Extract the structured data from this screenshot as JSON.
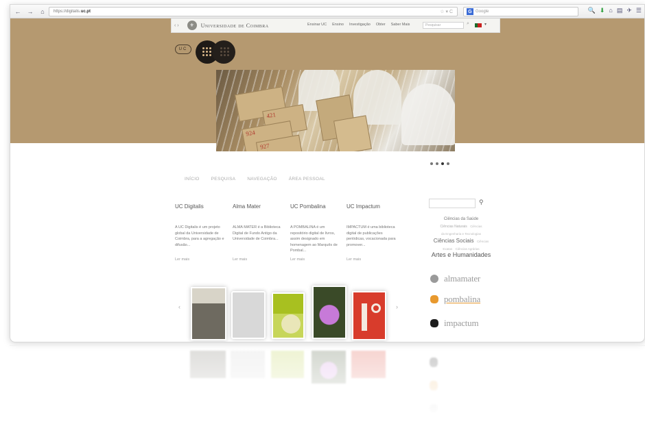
{
  "browser": {
    "nav_back": "←",
    "nav_forward": "→",
    "nav_home": "⌂",
    "url_prefix": "https://digitalis.",
    "url_domain": "uc.pt",
    "url_controls": "☆ ▾ C",
    "search_engine_letter": "G",
    "search_placeholder": "Google",
    "toolbar_icons": [
      "🔍",
      "⬇",
      "⌂",
      "▤",
      "✈",
      "☰"
    ]
  },
  "uc_bar": {
    "seal_glyph": "⚜",
    "arrows_left": "‹ ›",
    "name": "Universidade de Coimbra",
    "links": [
      "Ensinar UC",
      "Ensino",
      "Investigação",
      "Obter",
      "Saber Mais"
    ],
    "search_placeholder": "Pesquisar",
    "search_glyph": "⌕",
    "caret": "▾"
  },
  "logo": {
    "uc_text": "UC"
  },
  "hero_cards": [
    "421",
    "924",
    "927"
  ],
  "nav": {
    "items": [
      "INÍCIO",
      "PESQUISA",
      "NAVEGAÇÃO",
      "ÁREA PESSOAL"
    ]
  },
  "columns": [
    {
      "title": "UC Digitalis",
      "text": "A UC Digitalis é um projeto global da Universidade de Coimbra, para a agregação e difusão...",
      "more": "Ler mais"
    },
    {
      "title": "Alma Mater",
      "text": "ALMA MATER é a Biblioteca Digital de Fundo Antigo da Universidade de Coimbra...",
      "more": "Ler mais"
    },
    {
      "title": "UC Pombalina",
      "text": "A POMBALINA é um repositório digital de livros, assim designado em homenagem ao Marquês de Pombal...",
      "more": "Ler mais"
    },
    {
      "title": "UC Impactum",
      "text": "IMPACTUM é uma biblioteca digital de publicações periódicas, vocacionada para promover...",
      "more": "Ler mais"
    }
  ],
  "sidebar": {
    "search_glyph": "⚲",
    "tags": {
      "t1": "Ciências da Saúde",
      "t2": "Ciências Naturais",
      "t3a": "Ciências",
      "t3b": "da Engenharia e Tecnologias",
      "t4": "Ciências Sociais",
      "t5a": "Ciências",
      "t5b": "Exatas",
      "t5c": "Ciências Agrárias",
      "t6": "Artes e Humanidades"
    },
    "brands": [
      {
        "name": "almamater",
        "color": "#9a9a9a"
      },
      {
        "name": "pombalina",
        "color": "#e8992e"
      },
      {
        "name": "impactum",
        "color": "#1c1c1c"
      }
    ]
  },
  "carousel": {
    "prev": "‹",
    "next": "›",
    "books": [
      {
        "label": "",
        "color": "#6e6a60"
      },
      {
        "label": "",
        "color": "#e0e0e0"
      },
      {
        "label": "",
        "color": "#a8c020"
      },
      {
        "label": "",
        "color": "#3a4a28"
      },
      {
        "label": "",
        "color": "#d83c2c"
      }
    ]
  },
  "colors": {
    "hero_bg": "#b59970",
    "accent_orange": "#e8992e"
  }
}
